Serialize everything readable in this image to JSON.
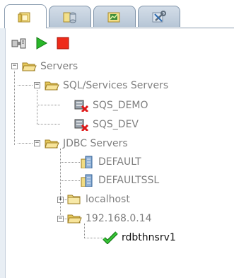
{
  "tabs": [
    {
      "icon": "folder-icon"
    },
    {
      "icon": "database-icon"
    },
    {
      "icon": "chart-icon"
    },
    {
      "icon": "tools-icon"
    }
  ],
  "toolbar": {
    "connect_icon": "connect-icon",
    "run_icon": "play-icon",
    "stop_icon": "stop-icon"
  },
  "tree": {
    "root": {
      "label": "Servers"
    },
    "sql": {
      "label": "SQL/Services Servers",
      "children": [
        "SQS_DEMO",
        "SQS_DEV"
      ]
    },
    "jdbc": {
      "label": "JDBC Servers"
    },
    "default": {
      "label": "DEFAULT"
    },
    "defaultssl": {
      "label": "DEFAULTSSL"
    },
    "localhost": {
      "label": "localhost"
    },
    "ip": {
      "label": "192.168.0.14"
    },
    "rdb": {
      "label": "rdbthnsrv1"
    }
  },
  "colors": {
    "status_ok": "#1fa21f",
    "status_err": "#e01818",
    "folder": "#f0d77a"
  }
}
